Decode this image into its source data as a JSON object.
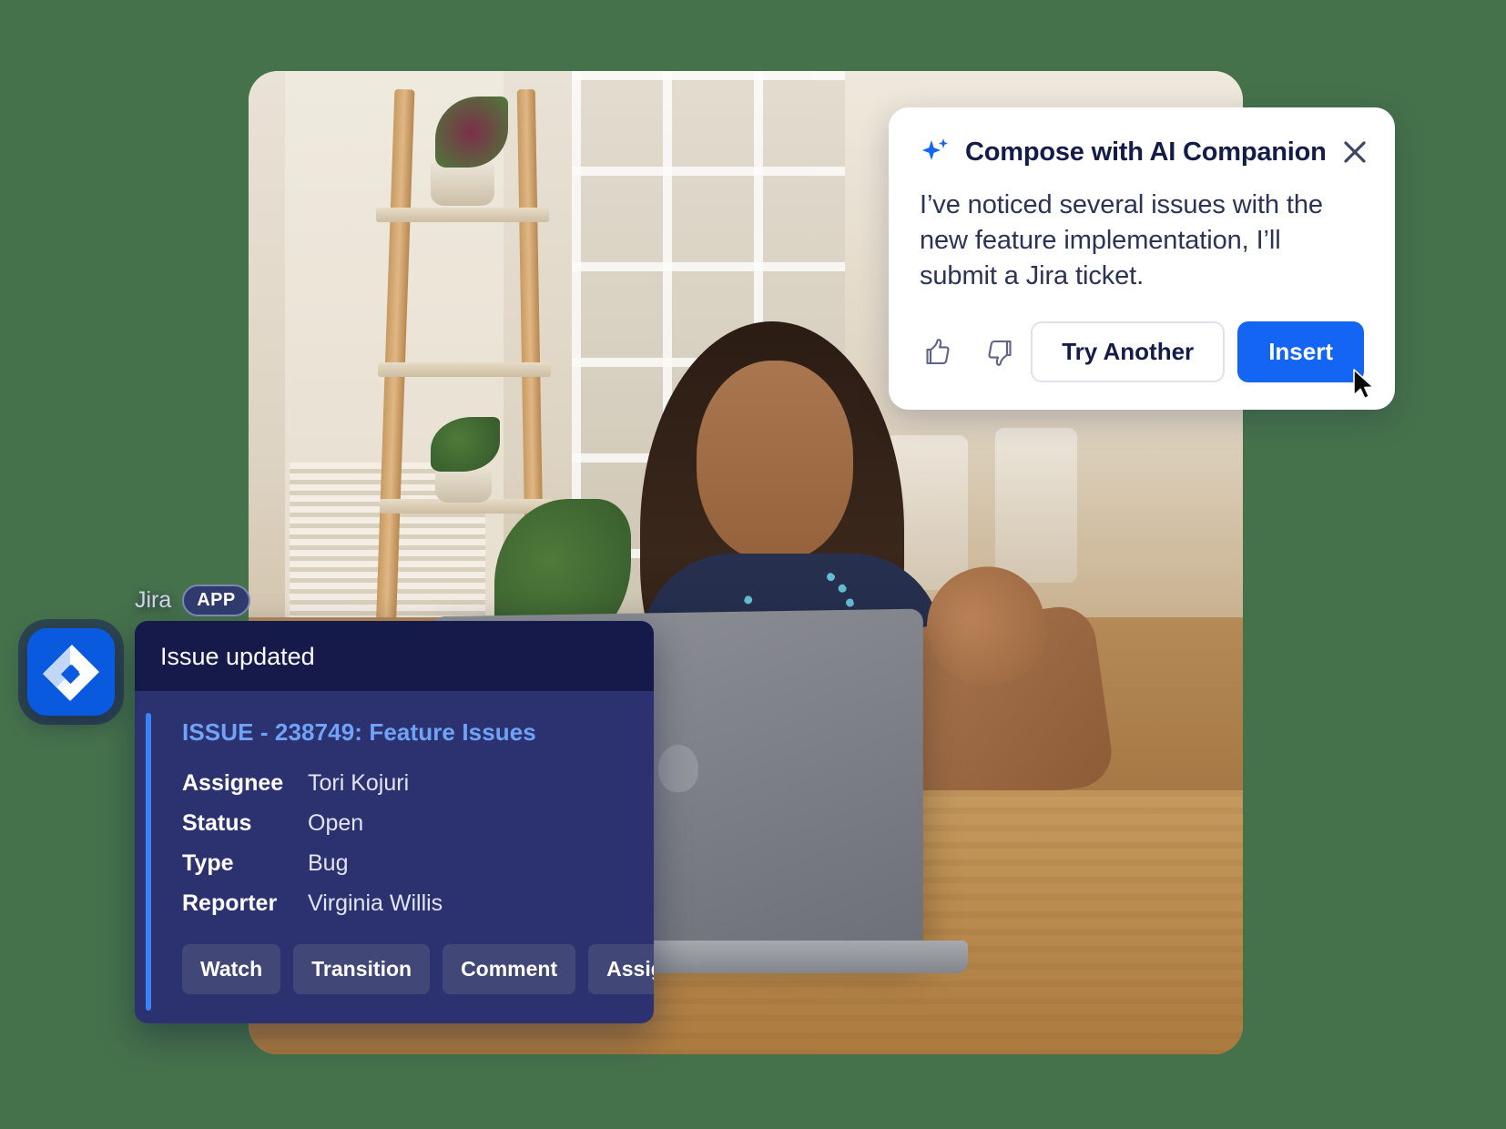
{
  "ai_card": {
    "sparkle_icon": "sparkle-icon",
    "title": "Compose with AI Companion",
    "close_icon": "close-icon",
    "message": "I’ve noticed several issues with the new feature implementation, I’ll submit a Jira ticket.",
    "thumbs_up_icon": "thumbs-up-icon",
    "thumbs_down_icon": "thumbs-down-icon",
    "try_another_label": "Try Another",
    "insert_label": "Insert",
    "cursor_icon": "mouse-cursor-icon",
    "accent_color": "#1565f5",
    "title_color": "#141c49",
    "surface_color": "#ffffff"
  },
  "jira_card": {
    "app_name": "Jira",
    "app_chip": "APP",
    "logo_icon": "jira-logo-icon",
    "header_title": "Issue updated",
    "issue_title": "ISSUE - 238749: Feature Issues",
    "fields": [
      {
        "key": "Assignee",
        "value": "Tori Kojuri"
      },
      {
        "key": "Status",
        "value": "Open"
      },
      {
        "key": "Type",
        "value": "Bug"
      },
      {
        "key": "Reporter",
        "value": "Virginia Willis"
      }
    ],
    "buttons": [
      "Watch",
      "Transition",
      "Comment",
      "Assign"
    ],
    "header_color": "#151a4a",
    "body_color": "#2c3270",
    "accent_color": "#3b82f6",
    "link_color": "#6fa3f7",
    "button_color": "#414878"
  },
  "photo": {
    "alt": "woman at laptop on video call in bright room",
    "background_color": "#46724b"
  }
}
